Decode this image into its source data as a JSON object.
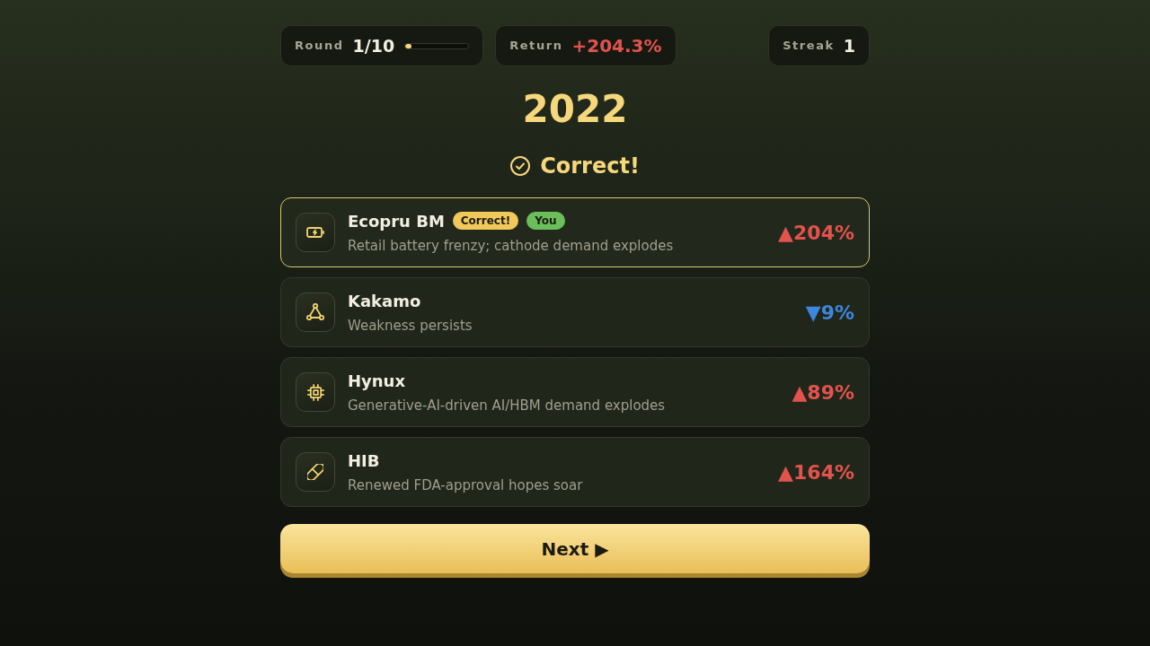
{
  "stats": {
    "round": {
      "label": "Round",
      "value": "1/10",
      "level": 0.1
    },
    "return": {
      "label": "Return",
      "value": "+204.3%",
      "rising": true
    },
    "streak": {
      "label": "Streak",
      "value": "1"
    }
  },
  "year": "2022",
  "result": {
    "text": "Correct!",
    "correct": true
  },
  "companies": [
    {
      "name": "Ecopru BM",
      "badges": [
        {
          "label": "Correct!",
          "kind": "correct"
        },
        {
          "label": "You",
          "kind": "you"
        }
      ],
      "description": "Retail battery frenzy; cathode demand explodes",
      "change": "▲204%",
      "rising": true,
      "selected": true
    },
    {
      "name": "Kakamo",
      "description": "Weakness persists",
      "change": "▼9%",
      "rising": false,
      "selected": false
    },
    {
      "name": "Hynux",
      "description": "Generative-AI-driven AI/HBM demand explodes",
      "change": "▲89%",
      "rising": true,
      "selected": false
    },
    {
      "name": "HIB",
      "description": "Renewed FDA-approval hopes soar",
      "change": "▲164%",
      "rising": true,
      "selected": false
    }
  ],
  "next_button": {
    "label": "Next ▶"
  }
}
